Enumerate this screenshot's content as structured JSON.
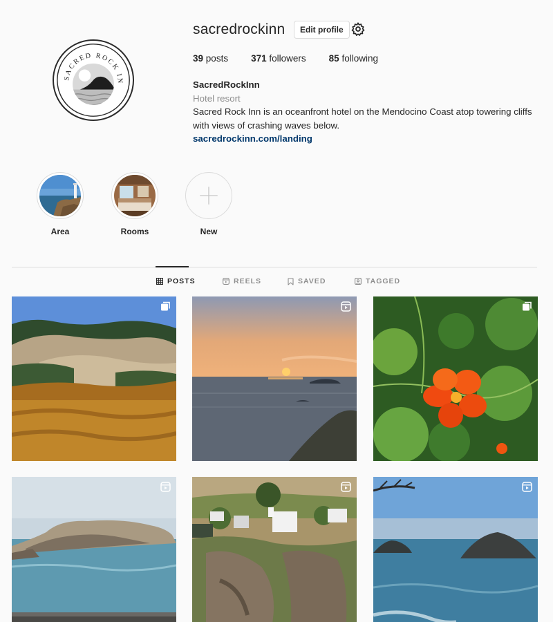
{
  "profile": {
    "username": "sacredrockinn",
    "edit_label": "Edit profile",
    "avatar_text": "SACRED ROCK INN",
    "stats": {
      "posts_count": "39",
      "posts_label": "posts",
      "followers_count": "371",
      "followers_label": "followers",
      "following_count": "85",
      "following_label": "following"
    },
    "display_name": "SacredRockInn",
    "category": "Hotel resort",
    "bio": "Sacred Rock Inn is an oceanfront hotel on the Mendocino Coast atop towering cliffs with views of crashing waves below.",
    "link": "sacredrockinn.com/landing"
  },
  "highlights": [
    {
      "label": "Area",
      "image": "lighthouse-coast"
    },
    {
      "label": "Rooms",
      "image": "hotel-room"
    },
    {
      "label": "New",
      "icon": "plus-icon"
    }
  ],
  "tabs": [
    {
      "label": "POSTS",
      "icon": "grid-icon",
      "active": true
    },
    {
      "label": "REELS",
      "icon": "reels-icon",
      "active": false
    },
    {
      "label": "SAVED",
      "icon": "bookmark-icon",
      "active": false
    },
    {
      "label": "TAGGED",
      "icon": "tagged-icon",
      "active": false
    }
  ],
  "posts": [
    {
      "subject": "autumn-vineyard-hills",
      "badge": "carousel-icon"
    },
    {
      "subject": "ocean-sunset",
      "badge": "reel-icon"
    },
    {
      "subject": "orange-nasturtium-flower",
      "badge": "carousel-icon"
    },
    {
      "subject": "sea-rock-island",
      "badge": "reel-icon"
    },
    {
      "subject": "clifftop-village",
      "badge": "reel-icon"
    },
    {
      "subject": "sea-stacks-ocean",
      "badge": "reel-icon"
    }
  ],
  "colors": {
    "link": "#00376b",
    "muted": "#8e8e8e",
    "border": "#dbdbdb",
    "text": "#262626"
  }
}
